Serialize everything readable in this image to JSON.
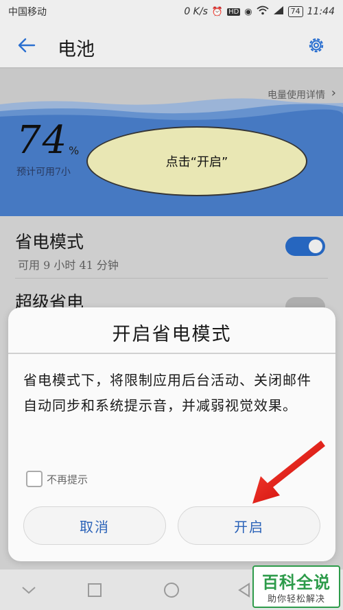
{
  "status_bar": {
    "carrier": "中国移动",
    "speed": "0 K/s",
    "battery": "74",
    "time": "11:44",
    "icons": [
      "alarm-icon",
      "hd-icon",
      "eye-icon",
      "wifi-icon",
      "signal-icon",
      "battery-icon"
    ]
  },
  "app_bar": {
    "title": "电池",
    "back_icon": "arrow-left-icon",
    "settings_icon": "gear-icon",
    "accent": "#2a6fd0"
  },
  "battery_card": {
    "usage_link": "电量使用详情",
    "percent": "74",
    "percent_sign": "%",
    "estimate": "预计可用7小"
  },
  "callout": {
    "text": "点击“开启”",
    "fill": "#fdfbc4"
  },
  "settings_list": {
    "power_saving": {
      "title": "省电模式",
      "subtitle": "可用 9 小时 41 分钟",
      "enabled": true
    },
    "ultra_power_saving": {
      "title": "超级省电",
      "enabled": false
    }
  },
  "dialog": {
    "title": "开启省电模式",
    "message": "省电模式下，将限制应用后台活动、关闭邮件自动同步和系统提示音，并减弱视觉效果。",
    "checkbox_label": "不再提示",
    "checkbox_checked": false,
    "cancel_label": "取消",
    "confirm_label": "开启",
    "button_text_color": "#2a62b8"
  },
  "annotation": {
    "arrow_color": "#e11010"
  },
  "nav_bar": {
    "icons": [
      "back-triangle-icon",
      "home-circle-icon",
      "recents-square-icon"
    ]
  },
  "watermark": {
    "title": "百科全说",
    "subtitle": "助你轻松解决",
    "color": "#2d9b4a"
  }
}
